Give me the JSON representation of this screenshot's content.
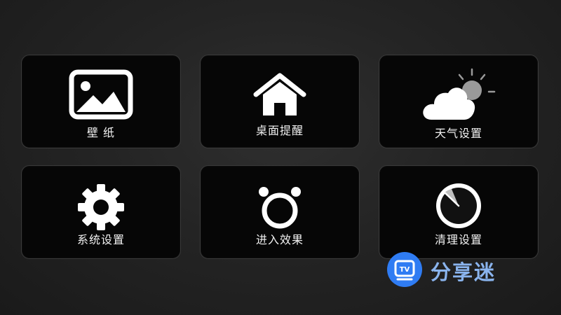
{
  "tiles": [
    {
      "id": "wallpaper",
      "label": "壁 纸",
      "icon": "image-icon"
    },
    {
      "id": "desktop",
      "label": "桌面提醒",
      "icon": "home-icon"
    },
    {
      "id": "weather",
      "label": "天气设置",
      "icon": "weather-icon"
    },
    {
      "id": "system",
      "label": "系统设置",
      "icon": "gear-icon"
    },
    {
      "id": "effect",
      "label": "进入效果",
      "icon": "ring-icon"
    },
    {
      "id": "clean",
      "label": "清理设置",
      "icon": "clean-dial-icon"
    }
  ],
  "watermark": {
    "badge_text": "TV",
    "brand": "分享迷",
    "badge_color": "#2f7cf3"
  }
}
